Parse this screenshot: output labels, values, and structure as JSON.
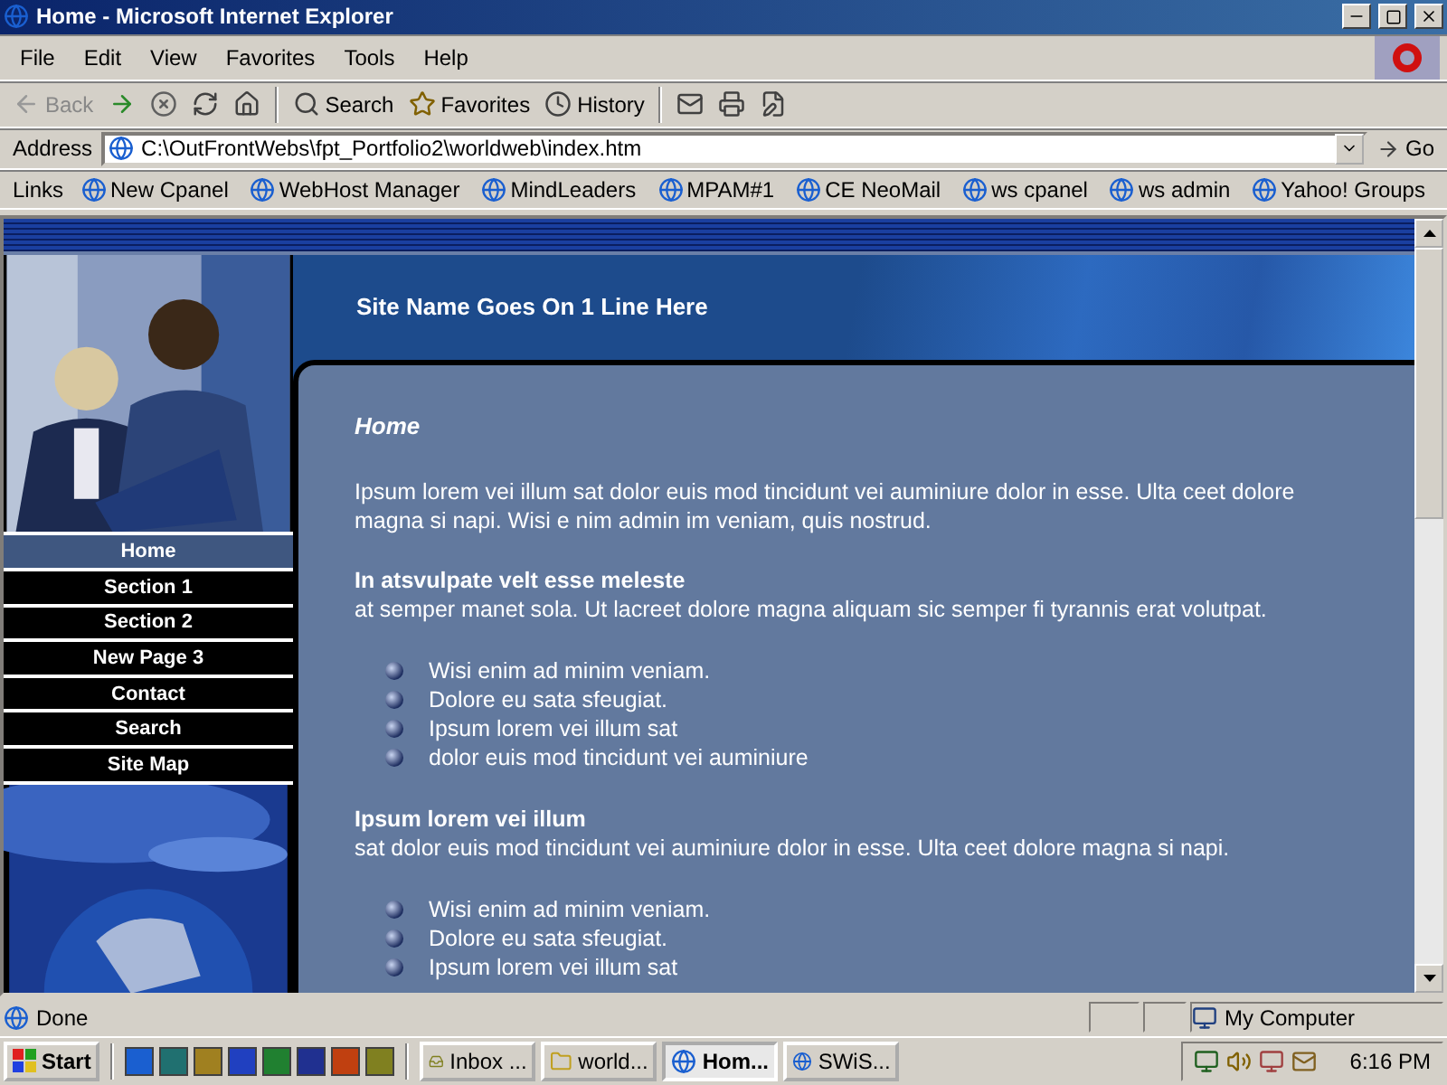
{
  "window": {
    "title": "Home - Microsoft Internet Explorer"
  },
  "menu": [
    "File",
    "Edit",
    "View",
    "Favorites",
    "Tools",
    "Help"
  ],
  "toolbar": [
    {
      "kind": "back",
      "label": "Back",
      "disabled": true
    },
    {
      "kind": "forward",
      "disabled": false
    },
    {
      "kind": "stop",
      "disabled": false
    },
    {
      "kind": "refresh",
      "disabled": false
    },
    {
      "kind": "home",
      "disabled": false
    },
    {
      "kind": "search",
      "label": "Search",
      "disabled": false
    },
    {
      "kind": "favorites",
      "label": "Favorites",
      "disabled": false
    },
    {
      "kind": "history",
      "label": "History",
      "disabled": false
    },
    {
      "kind": "mail",
      "disabled": false
    },
    {
      "kind": "print",
      "disabled": false
    },
    {
      "kind": "edit",
      "disabled": false
    }
  ],
  "address": {
    "label": "Address",
    "value": "C:\\OutFrontWebs\\fpt_Portfolio2\\worldweb\\index.htm",
    "go": "Go"
  },
  "links": {
    "label": "Links",
    "items": [
      "New Cpanel",
      "WebHost Manager",
      "MindLeaders",
      "MPAM#1",
      "CE NeoMail",
      "ws cpanel",
      "ws admin",
      "Yahoo! Groups"
    ]
  },
  "page": {
    "site_name": "Site Name Goes On 1 Line Here",
    "nav": [
      {
        "label": "Home",
        "selected": true
      },
      {
        "label": "Section 1",
        "selected": false
      },
      {
        "label": "Section 2",
        "selected": false
      },
      {
        "label": "New Page 3",
        "selected": false
      },
      {
        "label": "Contact",
        "selected": false
      },
      {
        "label": "Search",
        "selected": false
      },
      {
        "label": "Site Map",
        "selected": false
      }
    ],
    "title": "Home",
    "intro": "Ipsum lorem vei illum sat dolor euis mod tincidunt vei auminiure dolor in esse. Ulta ceet dolore magna si napi. Wisi e nim admin im veniam, quis nostrud.",
    "sections": [
      {
        "heading": "In atsvulpate velt esse meleste",
        "text": "at semper manet sola. Ut lacreet dolore magna aliquam sic semper fi tyrannis erat volutpat.",
        "bullets": [
          "Wisi enim ad minim veniam.",
          "Dolore eu sata sfeugiat.",
          "Ipsum lorem vei illum sat",
          "dolor euis mod tincidunt vei auminiure"
        ]
      },
      {
        "heading": "Ipsum lorem vei illum",
        "text": "sat dolor euis mod tincidunt vei auminiure dolor in esse. Ulta ceet dolore magna si napi.",
        "bullets": [
          "Wisi enim ad minim veniam.",
          "Dolore eu sata sfeugiat.",
          "Ipsum lorem vei illum sat"
        ]
      }
    ]
  },
  "status": {
    "text": "Done",
    "zone": "My Computer"
  },
  "taskbar": {
    "start": "Start",
    "tasks": [
      {
        "label": "Inbox ...",
        "selected": false
      },
      {
        "label": "world...",
        "selected": false
      },
      {
        "label": "Hom...",
        "selected": true
      },
      {
        "label": "SWiS...",
        "selected": false
      }
    ],
    "clock": "6:16 PM"
  }
}
